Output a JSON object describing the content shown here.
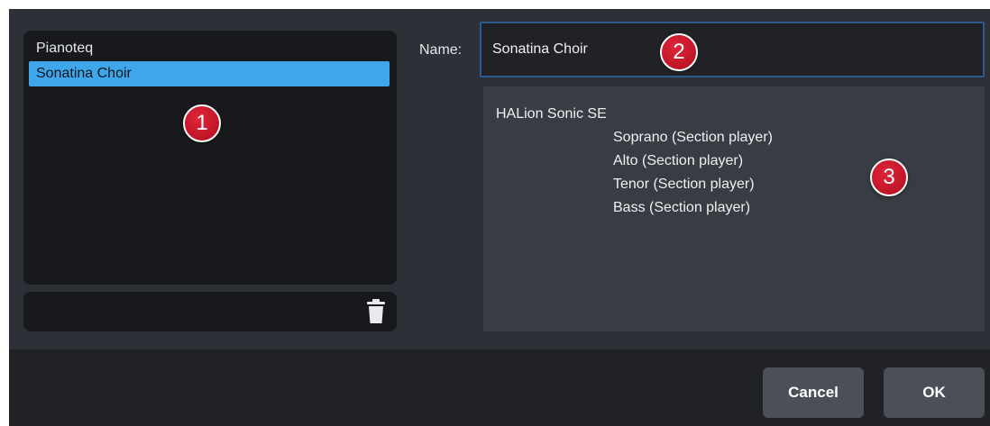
{
  "presets": {
    "items": [
      {
        "label": "Pianoteq",
        "selected": false
      },
      {
        "label": "Sonatina Choir",
        "selected": true
      }
    ],
    "delete_icon": "trash-icon"
  },
  "name_field": {
    "label": "Name:",
    "value": "Sonatina Choir"
  },
  "details": {
    "instrument": "HALion Sonic SE",
    "players": [
      "Soprano (Section player)",
      "Alto (Section player)",
      "Tenor (Section player)",
      "Bass (Section player)"
    ]
  },
  "callouts": [
    "1",
    "2",
    "3"
  ],
  "buttons": {
    "cancel": "Cancel",
    "ok": "OK"
  },
  "colors": {
    "selection": "#3ea6ea",
    "callout": "#c8152a"
  }
}
